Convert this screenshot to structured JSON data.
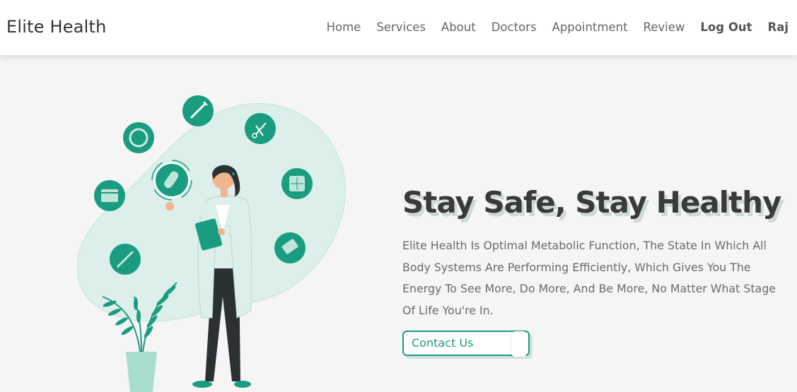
{
  "header": {
    "logo": "Elite Health",
    "nav": [
      "Home",
      "Services",
      "About",
      "Doctors",
      "Appointment",
      "Review"
    ],
    "logout": "Log Out",
    "user": "Raj"
  },
  "hero": {
    "title": "Stay Safe, Stay Healthy",
    "description": "Elite Health Is Optimal Metabolic Function, The State In Which All Body Systems Are Performing Efficiently, Which Gives You The Energy To See More, Do More, And Be More, No Matter What Stage Of Life You're In.",
    "button": "Contact Us"
  },
  "colors": {
    "accent": "#1a9c80",
    "blob": "#dcefea",
    "background": "#f5f5f5"
  }
}
